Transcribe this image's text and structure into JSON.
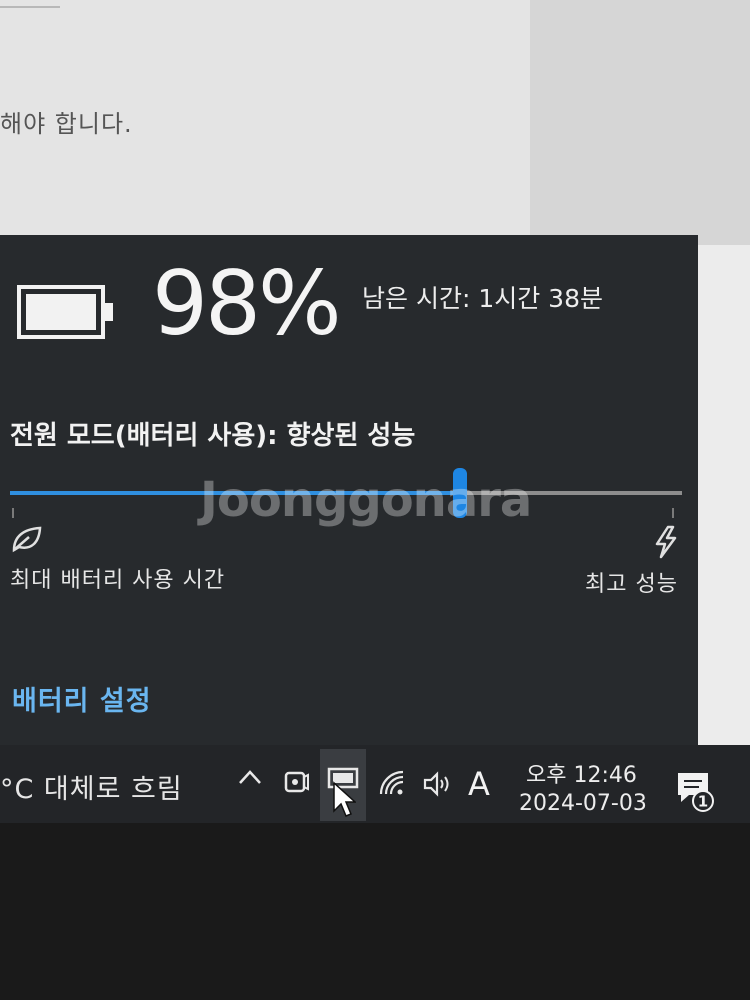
{
  "background_doc": {
    "visible_text": "해야 합니다."
  },
  "battery": {
    "percent": "98%",
    "percent_value": 98,
    "remaining": "남은 시간: 1시간 38분",
    "power_mode": "전원 모드(배터리 사용): 향상된 성능",
    "slider_level_fraction": 0.67,
    "slider_left_label": "최대 배터리 사용 시간",
    "slider_right_label": "최고 성능",
    "settings_link": "배터리 설정",
    "icons": [
      "battery-icon",
      "leaf-icon",
      "lightning-icon"
    ],
    "accent_color": "#2f8fe0",
    "link_color": "#6ab6f0"
  },
  "watermark": "Joonggonara",
  "taskbar": {
    "weather": "°C 대체로 흐림",
    "ime_indicator": "A",
    "time": "오후 12:46",
    "date": "2024-07-03",
    "notification_count": "1",
    "tray_icons": [
      "chevron-up-icon",
      "camera-icon",
      "battery-screen-icon",
      "wifi-icon",
      "volume-icon"
    ]
  }
}
